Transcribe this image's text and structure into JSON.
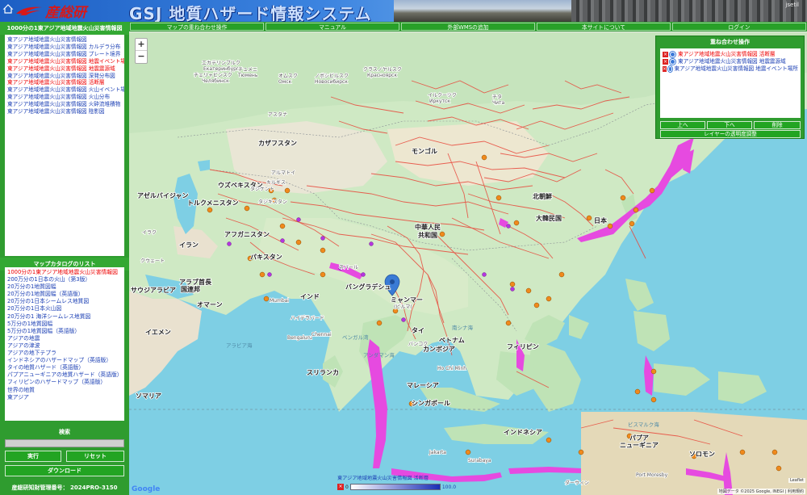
{
  "header": {
    "logo_text": "産総研",
    "title": "GSJ 地質ハザード情報システム",
    "user_label": "jsetil"
  },
  "menu": [
    "マップの重ね合わせ操作",
    "マニュアル",
    "外部WMSの追加",
    "本サイトについて",
    "ログイン"
  ],
  "left": {
    "layer_panel_title": "1000分の1東アジア地域地震火山災害情報図",
    "layers": [
      {
        "label": "東アジア地域地震火山災害情報図",
        "red": false
      },
      {
        "label": "東アジア地域地震火山災害情報図 カルデラ分布",
        "red": false
      },
      {
        "label": "東アジア地域地震火山災害情報図 プレート境界",
        "red": false
      },
      {
        "label": "東アジア地域地震火山災害情報図 地震イベント場所",
        "red": true
      },
      {
        "label": "東アジア地域地震火山災害情報図 地震震源域",
        "red": true
      },
      {
        "label": "東アジア地域地震火山災害情報図 深発分布図",
        "red": false
      },
      {
        "label": "東アジア地域地震火山災害情報図 活断層",
        "red": true
      },
      {
        "label": "東アジア地域地震火山災害情報図 火山イベント場所",
        "red": false
      },
      {
        "label": "東アジア地域地震火山災害情報図 火山分布",
        "red": false
      },
      {
        "label": "東アジア地域地震火山災害情報図 火砕流堆積物",
        "red": false
      },
      {
        "label": "東アジア地域地震火山災害情報図 陰影図",
        "red": false
      }
    ],
    "catalog_title": "マップカタログのリスト",
    "catalog": [
      {
        "label": "1000分の1東アジア地域地震火山災害情報図",
        "red": true
      },
      {
        "label": "200万分の1日本の火山（第3版）",
        "red": false
      },
      {
        "label": "20万分の1地質図幅",
        "red": false
      },
      {
        "label": "20万分の1地質図幅（英語版）",
        "red": false
      },
      {
        "label": "20万分の1日本シームレス地質図",
        "red": false
      },
      {
        "label": "20万分の1日本火山図",
        "red": false
      },
      {
        "label": "20万分の1 海洋シームレス地質図",
        "red": false
      },
      {
        "label": "5万分の1地質図幅",
        "red": false
      },
      {
        "label": "5万分の1地質図幅（英語版）",
        "red": false
      },
      {
        "label": "アジアの地震",
        "red": false
      },
      {
        "label": "アジアの津波",
        "red": false
      },
      {
        "label": "アジアの地下テプラ",
        "red": false
      },
      {
        "label": "インドネシアのハザードマップ（英語版）",
        "red": false
      },
      {
        "label": "タイの地質ハザード（英語版）",
        "red": false
      },
      {
        "label": "パプアニューギニアの地質ハザード（英語版）",
        "red": false
      },
      {
        "label": "フィリピンのハザードマップ（英語版）",
        "red": false
      },
      {
        "label": "世界の地質",
        "red": false
      },
      {
        "label": "東アジア",
        "red": false
      }
    ],
    "search_title": "検索",
    "run_label": "実行",
    "reset_label": "リセット",
    "download_label": "ダウンロード",
    "copyright": "産総研知財管理番号： 2024PRO-3150"
  },
  "overlay": {
    "title": "重ね合わせ操作",
    "items": [
      {
        "label": "東アジア地域地震火山災害情報図 活断層",
        "red": true
      },
      {
        "label": "東アジア地域地震火山災害情報図 地震震源域",
        "red": false
      },
      {
        "label": "東アジア地域地震火山災害情報図 地震イベント場所",
        "red": false
      }
    ],
    "up_label": "上へ",
    "down_label": "下へ",
    "delete_label": "削除",
    "transparency_label": "レイヤーの透明度調整"
  },
  "map": {
    "zoom_in": "+",
    "zoom_out": "−",
    "legend_title": "東アジア地域地震火山災害情報図 活断層",
    "legend_min": "0",
    "legend_max": "100.0",
    "attribution": "地図データ ©2025 Google, INEGI | 利用規約",
    "leaflet": "Leaflet",
    "google": "Google",
    "labels": {
      "russia_city1": "エカテリンブルク",
      "russia_city1b": "Екатеринбург",
      "russia_city2": "チェリャビンスク",
      "russia_city2b": "Челябинск",
      "russia_city3": "チュメニ",
      "russia_city3b": "Тюмень",
      "omsk": "オムスク",
      "omsk_b": "Омск",
      "novosibirsk": "ノボシビルスク",
      "novosibirsk_b": "Новосибирск",
      "krasnoyarsk": "クラスノヤルスク",
      "krasnoyarsk_b": "Красноярск",
      "irkutsk": "イルクーツク",
      "irkutsk_b": "Иркутск",
      "chita": "チタ",
      "chita_b": "Чита",
      "kazakhstan": "カザフスタン",
      "mongolia": "モンゴル",
      "uzbekistan": "ウズベキスタン",
      "turkmenistan": "トルクメニスタン",
      "azerbaijan": "アゼルバイジャン",
      "iran": "イラン",
      "afghanistan": "アフガニスタン",
      "pakistan": "パキスタン",
      "india": "インド",
      "china1": "中華人民",
      "china2": "共和国",
      "korea": "大韓民国",
      "north_korea": "北朝鮮",
      "japan": "日本",
      "bangladesh": "バングラデシュ",
      "myanmar": "ミャンマー",
      "myanmar2": "(ビルマ)",
      "thailand": "タイ",
      "vietnam": "ベトナム",
      "cambodia": "カンボジア",
      "philippines": "フィリピン",
      "malaysia": "マレーシア",
      "singapore": "シンガポール",
      "indonesia": "インドネシア",
      "png": "パプア",
      "png2": "ニューギニア",
      "solomon": "ソロモン",
      "iraq": "イラク",
      "kuwait": "クウェート",
      "saudi": "サウジアラビア",
      "uae": "アラブ首長",
      "uae2": "国連邦",
      "oman": "オマーン",
      "yemen": "イエメン",
      "somalia": "ソマリア",
      "sri_lanka": "スリランカ",
      "astana": "アスタナ",
      "almaty": "アルマトイ",
      "tashkent": "タシケント",
      "kyrgyz": "キルギス",
      "tajik": "タジキスタン",
      "nepal": "ネパール",
      "bay_of_bengal": "ベンガル湾",
      "arabian_sea": "アラビア海",
      "andaman": "アンダマン海",
      "south_china_sea": "南シナ海",
      "mumbai": "Mumbai",
      "hyderabad": "ハイデラバード",
      "bengaluru": "Bengaluru",
      "chennai": "Chennai",
      "bangkok": "バンコク",
      "hcmc": "Ho Chi Minh",
      "jakarta": "Jakarta",
      "surabaya": "Surabaya",
      "darwin": "ダーウィン",
      "port_moresby": "Port Moresby",
      "bismarck": "ビスマルク海"
    }
  }
}
